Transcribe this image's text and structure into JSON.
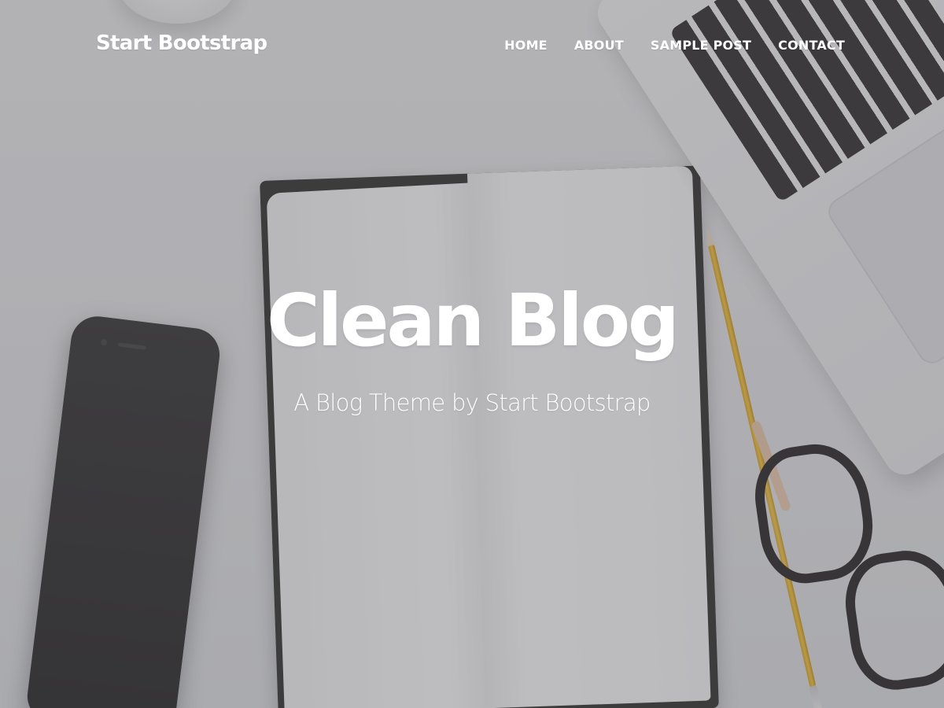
{
  "navbar": {
    "brand": "Start Bootstrap",
    "links": [
      {
        "label": "HOME"
      },
      {
        "label": "ABOUT"
      },
      {
        "label": "SAMPLE POST"
      },
      {
        "label": "CONTACT"
      }
    ]
  },
  "hero": {
    "title": "Clean Blog",
    "subtitle": "A Blog Theme by Start Bootstrap",
    "background_description": "desk-scene",
    "overlay_color": "#5a5a5f"
  }
}
